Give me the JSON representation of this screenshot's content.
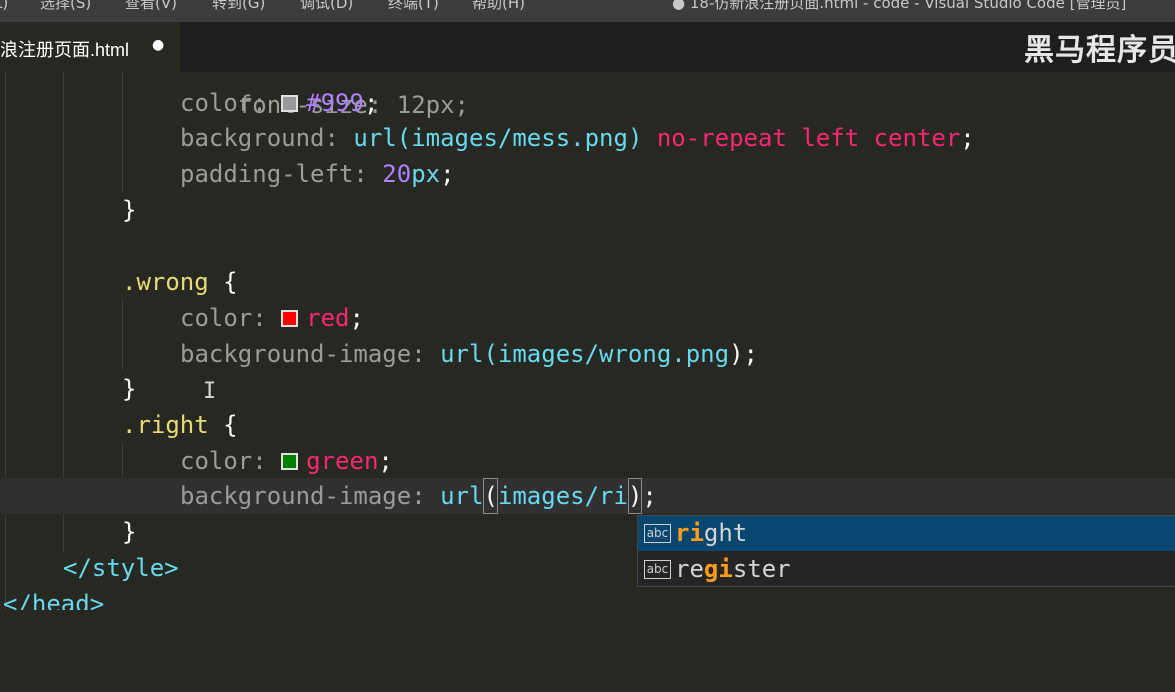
{
  "menubar": {
    "items": [
      "L)",
      "选择(S)",
      "查看(V)",
      "转到(G)",
      "调试(D)",
      "终端(T)",
      "帮助(H)"
    ]
  },
  "window_title": "● 18-仿新浪注册页面.html - code - Visual Studio Code [管理员]",
  "tab": {
    "label": "浪注册页面.html",
    "dirty_marker": "●"
  },
  "watermark": "黑马程序员",
  "code": {
    "l0_prop": "font-size: 12px;",
    "l1_prop": "color:",
    "l1_val": "#999",
    "l1_semi": ";",
    "l2_prop": "background:",
    "l2_url": "url(",
    "l2_path": "images/mess.png",
    "l2_close": ")",
    "l2_kw": "no-repeat left center",
    "l2_semi": ";",
    "l3_prop": "padding-left:",
    "l3_num": "20",
    "l3_unit": "px",
    "l3_semi": ";",
    "l4_brace": "}",
    "l6_sel": ".wrong",
    "l6_brace": "{",
    "l7_prop": "color:",
    "l7_val": "red",
    "l7_semi": ";",
    "l8_prop": "background-image:",
    "l8_url": "url(",
    "l8_path": "images/wrong.png",
    "l8_close": ");",
    "l9_brace": "}",
    "l10_sel": ".right",
    "l10_brace": "{",
    "l11_prop": "color:",
    "l11_val": "green",
    "l11_semi": ";",
    "l12_prop": "background-image:",
    "l12_url": "url",
    "l12_open": "(",
    "l12_path": "images/ri",
    "l12_close": ")",
    "l12_semi": ";",
    "l13_brace": "}",
    "l14_tag": "</style>",
    "l15_tag": "</head>"
  },
  "swatch_colors": {
    "gray": "#999999",
    "red": "#ff0000",
    "green": "#008000"
  },
  "suggestions": [
    {
      "icon": "abc",
      "match": "ri",
      "rest": "ght"
    },
    {
      "icon": "abc",
      "pre": "re",
      "match": "gi",
      "rest": "ster"
    }
  ]
}
